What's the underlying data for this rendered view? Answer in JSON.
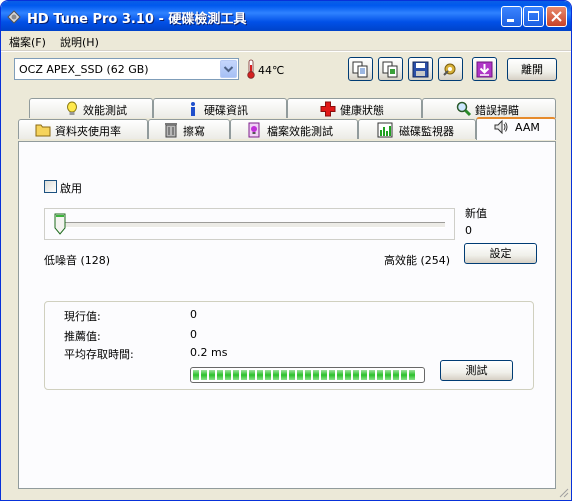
{
  "window": {
    "title": "HD Tune Pro 3.10 - 硬碟檢測工具"
  },
  "menu": {
    "file": "檔案(F)",
    "help": "說明(H)"
  },
  "toolbar": {
    "drive": "OCZ APEX_SSD (62 GB)",
    "temperature": "44℃",
    "exit_label": "離開"
  },
  "tabs_top": [
    {
      "label": "效能測試",
      "icon": "lightbulb-icon"
    },
    {
      "label": "硬碟資訊",
      "icon": "info-icon"
    },
    {
      "label": "健康狀態",
      "icon": "health-cross-icon"
    },
    {
      "label": "錯誤掃瞄",
      "icon": "magnifier-icon"
    }
  ],
  "tabs_bottom": [
    {
      "label": "資料夾使用率",
      "icon": "folder-icon"
    },
    {
      "label": "擦寫",
      "icon": "trash-icon"
    },
    {
      "label": "檔案效能測試",
      "icon": "file-benchmark-icon"
    },
    {
      "label": "磁碟監視器",
      "icon": "monitor-chart-icon"
    },
    {
      "label": "AAM",
      "icon": "speaker-icon"
    }
  ],
  "aam": {
    "enable_label": "啟用",
    "enabled": false,
    "new_value_label": "新值",
    "new_value": "0",
    "low_noise_label": "低噪音 (128)",
    "high_perf_label": "高效能 (254)",
    "set_button": "設定",
    "slider_position": 0
  },
  "stats": {
    "current_label": "現行值:",
    "current_value": "0",
    "recommended_label": "推薦值:",
    "recommended_value": "0",
    "access_time_label": "平均存取時間:",
    "access_time_value": "0.2 ms",
    "test_button": "測試",
    "progress_percent": 100
  },
  "colors": {
    "title_bar": "#0058ee",
    "progress_green": "#2cc12c",
    "active_tab_accent": "#e68b2c"
  }
}
